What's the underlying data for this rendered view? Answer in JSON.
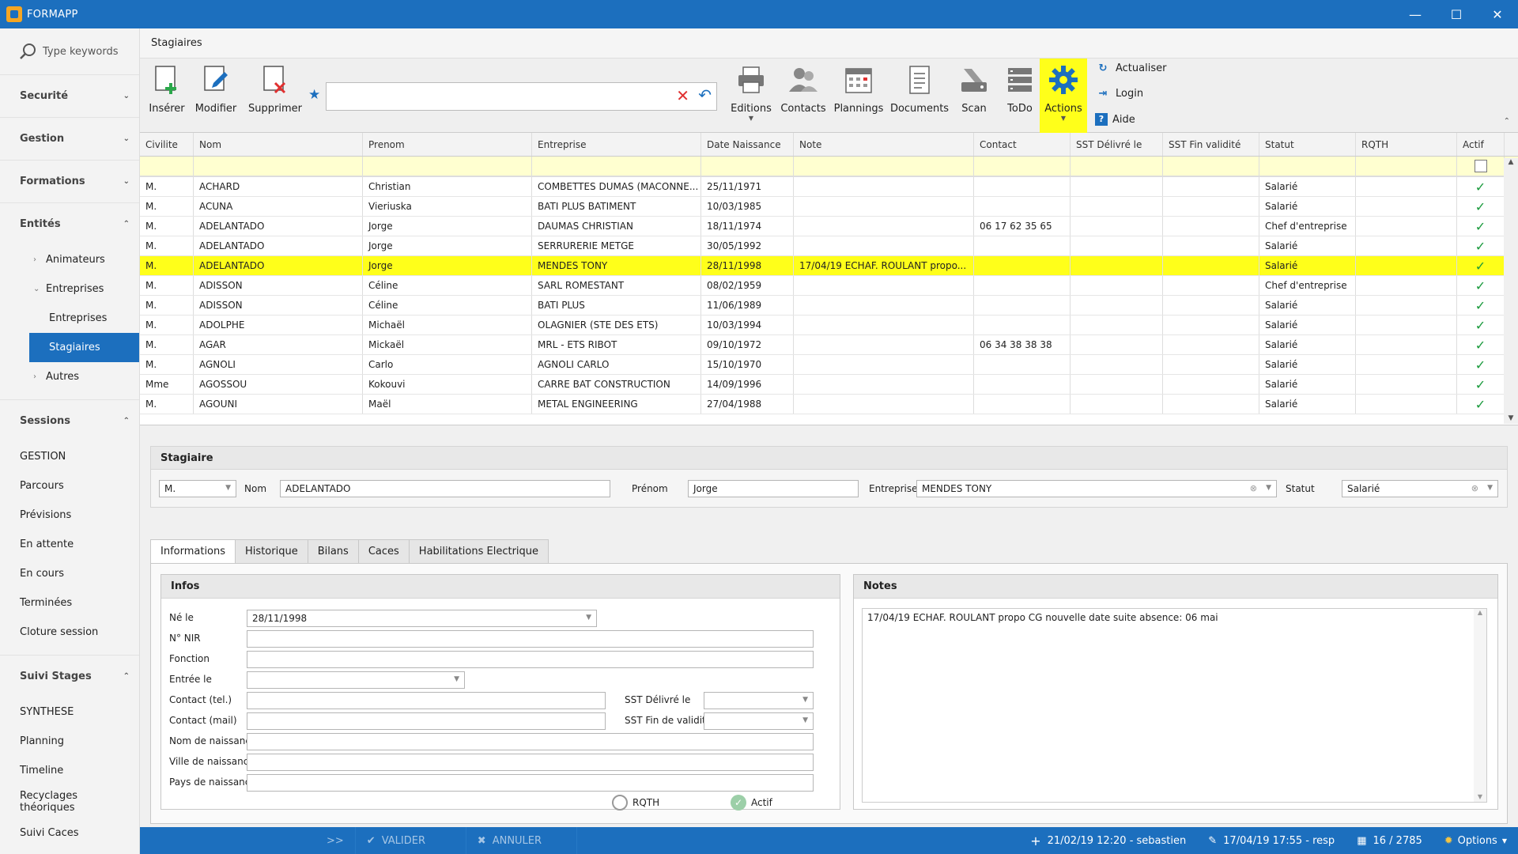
{
  "app": {
    "title": "FORMAPP",
    "minimize": "—",
    "maximize": "☐",
    "close": "✕"
  },
  "sidebar": {
    "search_placeholder": "Type keywords",
    "groups": [
      {
        "label": "Securité",
        "chev": "⌄"
      },
      {
        "label": "Gestion",
        "chev": "⌄"
      },
      {
        "label": "Formations",
        "chev": "⌄"
      },
      {
        "label": "Entités",
        "chev": "⌃"
      }
    ],
    "entites_items": [
      {
        "label": "Animateurs"
      },
      {
        "label": "Entreprises"
      },
      {
        "label": "Entreprises"
      },
      {
        "label": "Stagiaires"
      },
      {
        "label": "Autres"
      }
    ],
    "sessions": {
      "label": "Sessions",
      "chev": "⌃",
      "items": [
        "GESTION",
        "Parcours",
        "Prévisions",
        "En attente",
        "En cours",
        "Terminées",
        "Cloture session"
      ]
    },
    "suivi": {
      "label": "Suivi Stages",
      "chev": "⌃",
      "items": [
        "SYNTHESE",
        "Planning",
        "Timeline",
        "Recyclages théoriques",
        "Suivi Caces"
      ]
    }
  },
  "page": {
    "title": "Stagiaires"
  },
  "ribbon": {
    "inserer": "Insérer",
    "modifier": "Modifier",
    "supprimer": "Supprimer",
    "editions": "Editions",
    "contacts": "Contacts",
    "plannings": "Plannings",
    "documents": "Documents",
    "scan": "Scan",
    "todo": "ToDo",
    "actions": "Actions",
    "actualiser": "Actualiser",
    "login": "Login",
    "aide": "Aide",
    "search_value": ""
  },
  "grid": {
    "columns": [
      "Civilite",
      "Nom",
      "Prenom",
      "Entreprise",
      "Date Naissance",
      "Note",
      "Contact",
      "SST Délivré le",
      "SST Fin validité",
      "Statut",
      "RQTH",
      "Actif"
    ],
    "rows": [
      [
        "M.",
        "ACHARD",
        "Christian",
        "COMBETTES DUMAS (MACONNE...",
        "25/11/1971",
        "",
        "",
        "",
        "",
        "Salarié",
        "",
        ""
      ],
      [
        "M.",
        "ACUNA",
        "Vieriuska",
        "BATI PLUS BATIMENT",
        "10/03/1985",
        "",
        "",
        "",
        "",
        "Salarié",
        "",
        ""
      ],
      [
        "M.",
        "ADELANTADO",
        "Jorge",
        "DAUMAS CHRISTIAN",
        "18/11/1974",
        "",
        "06 17 62 35 65",
        "",
        "",
        "Chef d'entreprise",
        "",
        ""
      ],
      [
        "M.",
        "ADELANTADO",
        "Jorge",
        "SERRURERIE METGE",
        "30/05/1992",
        "",
        "",
        "",
        "",
        "Salarié",
        "",
        ""
      ],
      [
        "M.",
        "ADELANTADO",
        "Jorge",
        "MENDES TONY",
        "28/11/1998",
        "17/04/19 ECHAF. ROULANT propo...",
        "",
        "",
        "",
        "Salarié",
        "",
        ""
      ],
      [
        "M.",
        "ADISSON",
        "Céline",
        "SARL ROMESTANT",
        "08/02/1959",
        "",
        "",
        "",
        "",
        "Chef d'entreprise",
        "",
        ""
      ],
      [
        "M.",
        "ADISSON",
        "Céline",
        "BATI PLUS",
        "11/06/1989",
        "",
        "",
        "",
        "",
        "Salarié",
        "",
        ""
      ],
      [
        "M.",
        "ADOLPHE",
        "Michaël",
        "OLAGNIER (STE DES ETS)",
        "10/03/1994",
        "",
        "",
        "",
        "",
        "Salarié",
        "",
        ""
      ],
      [
        "M.",
        "AGAR",
        "Mickaël",
        "MRL - ETS RIBOT",
        "09/10/1972",
        "",
        "06 34 38 38 38",
        "",
        "",
        "Salarié",
        "",
        ""
      ],
      [
        "M.",
        "AGNOLI",
        "Carlo",
        "AGNOLI CARLO",
        "15/10/1970",
        "",
        "",
        "",
        "",
        "Salarié",
        "",
        ""
      ],
      [
        "Mme",
        "AGOSSOU",
        "Kokouvi",
        "CARRE BAT CONSTRUCTION",
        "14/09/1996",
        "",
        "",
        "",
        "",
        "Salarié",
        "",
        ""
      ],
      [
        "M.",
        "AGOUNI",
        "Maël",
        "METAL ENGINEERING",
        "27/04/1988",
        "",
        "",
        "",
        "",
        "Salarié",
        "",
        ""
      ]
    ],
    "check_mark": "✓"
  },
  "detail": {
    "title": "Stagiaire",
    "civilite": "M.",
    "nom_label": "Nom",
    "nom": "ADELANTADO",
    "prenom_label": "Prénom",
    "prenom": "Jorge",
    "entreprise_label": "Entreprise",
    "entreprise": "MENDES TONY",
    "statut_label": "Statut",
    "statut": "Salarié",
    "tabs": [
      "Informations",
      "Historique",
      "Bilans",
      "Caces",
      "Habilitations Electrique"
    ],
    "infos_title": "Infos",
    "ne_le_label": "Né le",
    "ne_le": "28/11/1998",
    "nir_label": "N° NIR",
    "fonction_label": "Fonction",
    "entree_label": "Entrée le",
    "contact_tel_label": "Contact (tel.)",
    "contact_mail_label": "Contact (mail)",
    "sst_delivre_label": "SST Délivré le",
    "sst_fin_label": "SST Fin de validité",
    "nom_naissance_label": "Nom de naissance",
    "ville_naissance_label": "Ville de naissance",
    "pays_naissance_label": "Pays de naissance",
    "rqth_label": "RQTH",
    "actif_label": "Actif",
    "notes_title": "Notes",
    "notes": "17/04/19 ECHAF. ROULANT propo CG nouvelle date suite absence: 06 mai"
  },
  "status": {
    "expand": ">>",
    "valider": "VALIDER",
    "annuler": "ANNULER",
    "created": "21/02/19 12:20 - sebastien",
    "modified": "17/04/19 17:55 - resp",
    "count": "16 / 2785",
    "options": "Options"
  },
  "colors": {
    "accent": "#1c6fbe",
    "highlight": "#ffff1a",
    "check": "#1a9a3c",
    "delete": "#e03030"
  }
}
